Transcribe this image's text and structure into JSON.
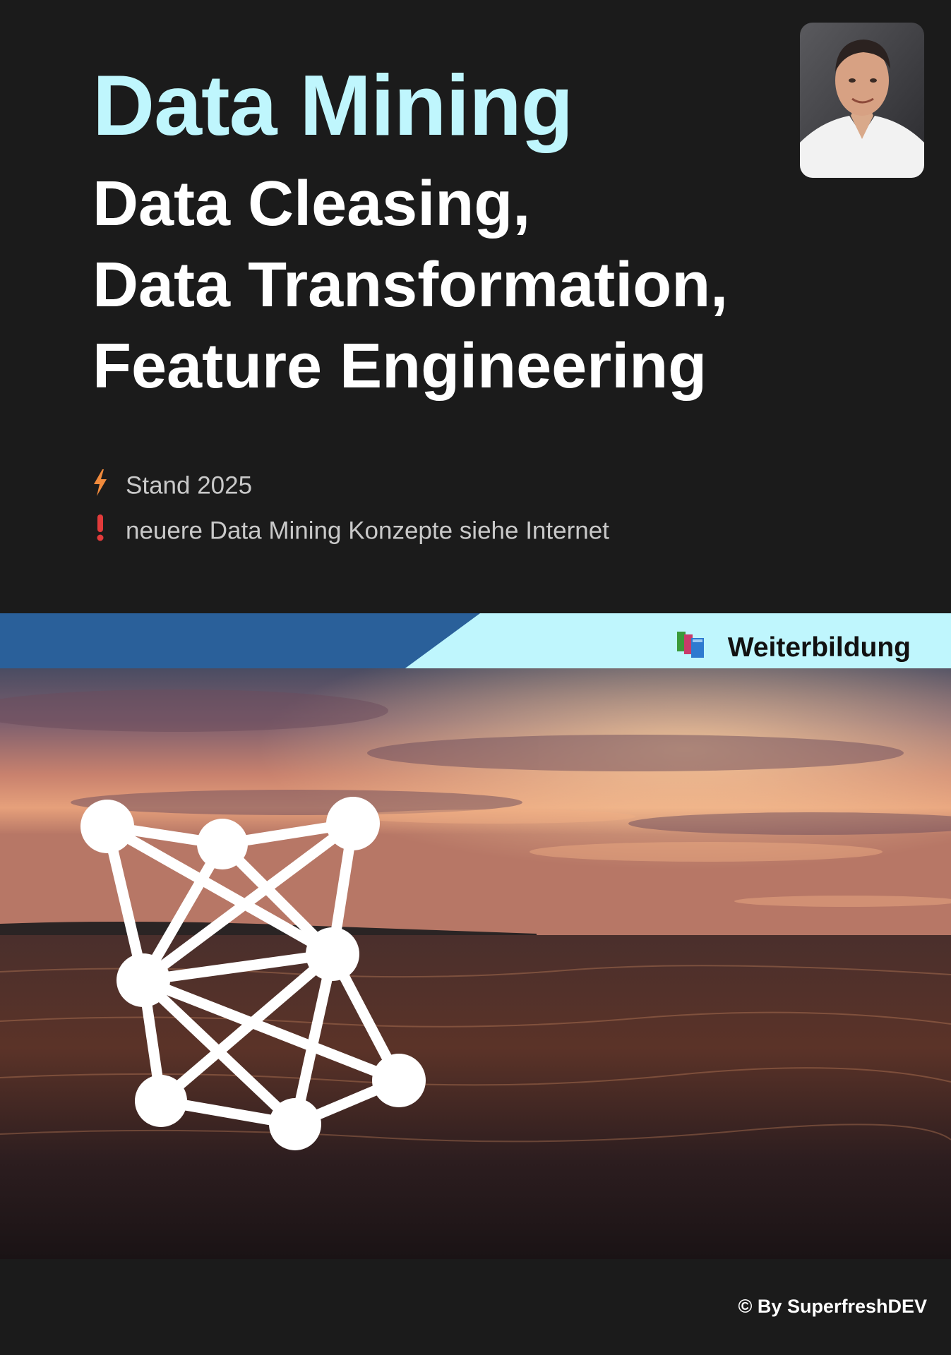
{
  "title": "Data Mining",
  "subtitle_lines": [
    "Data Cleasing,",
    "Data Transformation,",
    "Feature Engineering"
  ],
  "meta": [
    {
      "icon": "lightning-icon",
      "text": "Stand 2025",
      "color": "#f08a3c"
    },
    {
      "icon": "exclamation-icon",
      "text": "neuere Data Mining Konzepte siehe Internet",
      "color": "#e23b3b"
    }
  ],
  "badge": {
    "icon": "books-icon",
    "label": "Weiterbildung"
  },
  "credit": "© By SuperfreshDEV",
  "colors": {
    "background": "#1b1b1b",
    "title": "#bff6fd",
    "banner_dark": "#2a609a",
    "banner_light": "#bff6fd"
  }
}
